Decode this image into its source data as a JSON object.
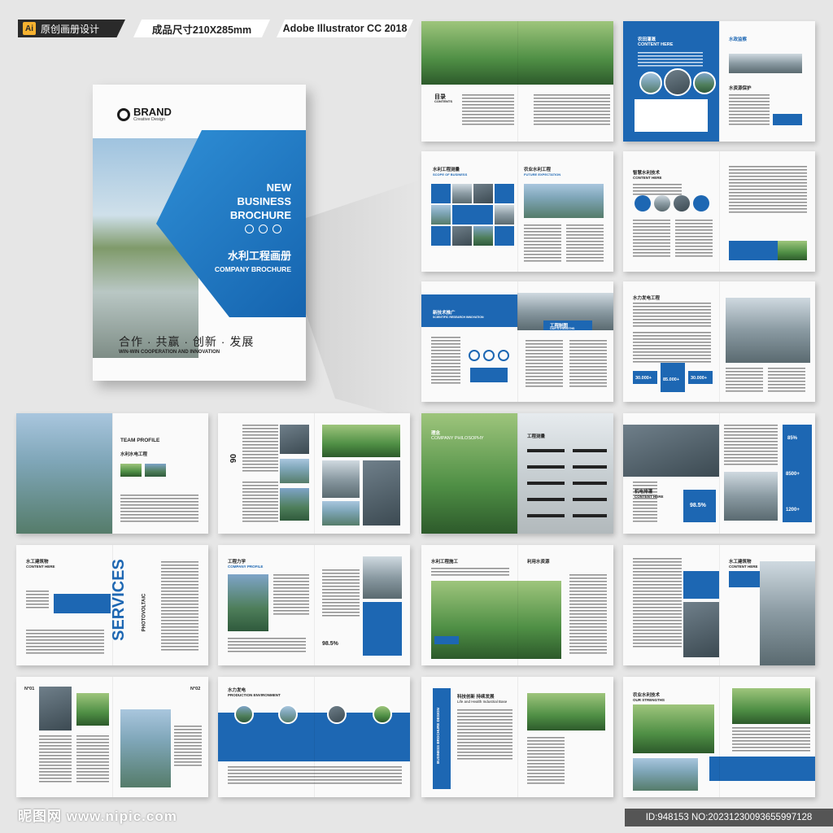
{
  "header": {
    "badge_design": "原创画册设计",
    "ai_icon": "Ai",
    "badge_size": "成品尺寸210X285mm",
    "badge_software": "Adobe Illustrator CC 2018"
  },
  "cover": {
    "brand": "BRAND",
    "brand_sub": "Creative Design",
    "title_lines": [
      "NEW",
      "BUSINESS",
      "BROCHURE"
    ],
    "cn_title": "水利工程画册",
    "en_title": "COMPANY BROCHURE",
    "slogan": "合作 · 共赢 · 创新 · 发展",
    "slogan_en": "WIN-WIN COOPERATION AND INNOVATION"
  },
  "spreads": {
    "s1_left": "目录",
    "s1_left_en": "CONTENTS",
    "s2_left": "农田灌溉",
    "s2_left_en": "CONTENT HERE",
    "s2_right": "水政监察",
    "s2_right2": "水资源保护",
    "s3_left": "水利工程测量",
    "s3_left_en": "SCOPE OF BUSINESS",
    "s3_right": "农业水利工程",
    "s3_right_en": "FUTURE EXPECTATION",
    "s4_left": "智慧水利技术",
    "s4_left_en": "CONTENT HERE",
    "s5_left": "新技术推广",
    "s5_left_en": "SCIENTIFIC RESEARCH INNOVATION",
    "s5_right": "工程制图",
    "s5_right_en": "OUR STRENGTHS",
    "s6_left": "水力发电工程",
    "s6_stat1": "30.000+",
    "s6_stat2": "85.000+",
    "s6_stat3": "30.000+",
    "s7_left": "TEAM PROFILE",
    "s7_left_cn": "水利水电工程",
    "s8_left": "06",
    "s9_left": "理念",
    "s9_left_en": "COMPANY PHILOSOPHY",
    "s9_right": "工程测量",
    "s10_right": "机电排灌",
    "s10_right_en": "CONTENT HERE",
    "s10_stat1": "85%",
    "s10_stat2": "8500+",
    "s10_stat3": "98.5%",
    "s10_stat4": "1200+",
    "s11_left": "水工建筑物",
    "s11_left_en": "CONTENT HERE",
    "s11_big": "SERVICES",
    "s11_sub": "PHOTOVOLTAIC",
    "s12_left": "工程力学",
    "s12_left_en": "COMPANY PROFILE",
    "s12_stat": "98.5%",
    "s13_left": "水利工程施工",
    "s13_right": "利用水资源",
    "s14_left": "水工建筑物",
    "s14_left_en": "CONTENT HERE",
    "s15_left": "N°01",
    "s15_right": "N°02",
    "s16_left": "水力发电",
    "s16_left_en": "PRODUCTION ENVIRONMENT",
    "s17_left": "BUSINESS BROCHURE DESIGN",
    "s17_right": "科技创新 持续发展",
    "s17_right_en": "Life and Health Industrial Base",
    "s18_right": "农业水利技术",
    "s18_right_en": "OUR STRENGTHS"
  },
  "watermark": {
    "site": "昵图网 www.nipic.com",
    "id": "ID:948153 NO:20231230093655997128"
  },
  "colors": {
    "accent": "#1d67b3",
    "accent_light": "#3f8fd3"
  }
}
